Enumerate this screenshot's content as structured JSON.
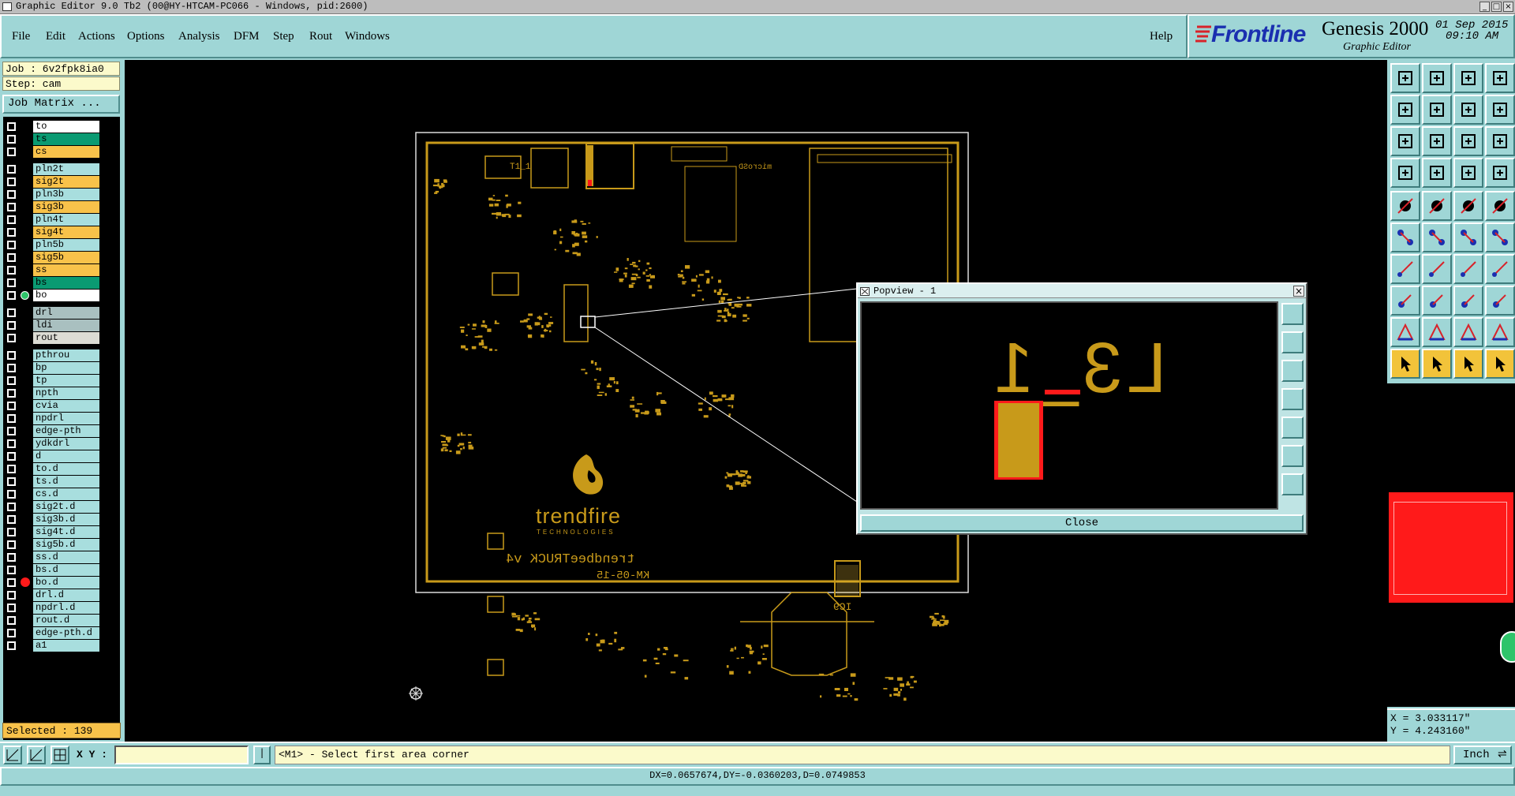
{
  "window": {
    "title": "Graphic Editor 9.0 Tb2 (00@HY-HTCAM-PC066 - Windows, pid:2600)",
    "controls": [
      "_",
      "□",
      "×"
    ]
  },
  "menu": {
    "items": [
      "File",
      "Edit",
      "Actions",
      "Options",
      "Analysis",
      "DFM",
      "Step",
      "Rout",
      "Windows"
    ],
    "help": "Help"
  },
  "brand": {
    "logo": "Frontline",
    "product": "Genesis 2000",
    "subtitle": "Graphic Editor",
    "date": "01 Sep 2015",
    "time": "09:10 AM"
  },
  "job": {
    "job_label": "Job : 6v2fpk8ia0",
    "step_label": "Step: cam",
    "matrix_button": "Job Matrix ..."
  },
  "layers": [
    {
      "name": "to",
      "color": "#ffffff"
    },
    {
      "name": "ts",
      "color": "#0a9a72"
    },
    {
      "name": "cs",
      "color": "#f8c24a"
    },
    {
      "name": "pln2t",
      "color": "#a8dede"
    },
    {
      "name": "sig2t",
      "color": "#f8c24a"
    },
    {
      "name": "pln3b",
      "color": "#a8dede"
    },
    {
      "name": "sig3b",
      "color": "#f8c24a"
    },
    {
      "name": "pln4t",
      "color": "#a8dede"
    },
    {
      "name": "sig4t",
      "color": "#f8c24a"
    },
    {
      "name": "pln5b",
      "color": "#a8dede"
    },
    {
      "name": "sig5b",
      "color": "#f8c24a"
    },
    {
      "name": "ss",
      "color": "#f8c24a"
    },
    {
      "name": "bs",
      "color": "#0a9a72"
    },
    {
      "name": "bo",
      "color": "#ffffff"
    },
    {
      "name": "drl",
      "color": "#a9c0c0"
    },
    {
      "name": "ldi",
      "color": "#a9c0c0"
    },
    {
      "name": "rout",
      "color": "#dcdcd4"
    },
    {
      "name": "pthrou",
      "color": "#a8dede"
    },
    {
      "name": "bp",
      "color": "#a8dede"
    },
    {
      "name": "tp",
      "color": "#a8dede"
    },
    {
      "name": "npth",
      "color": "#a8dede"
    },
    {
      "name": "cvia",
      "color": "#a8dede"
    },
    {
      "name": "npdrl",
      "color": "#a8dede"
    },
    {
      "name": "edge-pth",
      "color": "#a8dede"
    },
    {
      "name": "ydkdrl",
      "color": "#a8dede"
    },
    {
      "name": "d",
      "color": "#a8dede"
    },
    {
      "name": "to.d",
      "color": "#a8dede"
    },
    {
      "name": "ts.d",
      "color": "#a8dede"
    },
    {
      "name": "cs.d",
      "color": "#a8dede"
    },
    {
      "name": "sig2t.d",
      "color": "#a8dede"
    },
    {
      "name": "sig3b.d",
      "color": "#a8dede"
    },
    {
      "name": "sig4t.d",
      "color": "#a8dede"
    },
    {
      "name": "sig5b.d",
      "color": "#a8dede"
    },
    {
      "name": "ss.d",
      "color": "#a8dede"
    },
    {
      "name": "bs.d",
      "color": "#a8dede"
    },
    {
      "name": "bo.d",
      "color": "#a8dede"
    },
    {
      "name": "drl.d",
      "color": "#a8dede"
    },
    {
      "name": "npdrl.d",
      "color": "#a8dede"
    },
    {
      "name": "rout.d",
      "color": "#a8dede"
    },
    {
      "name": "edge-pth.d",
      "color": "#a8dede"
    },
    {
      "name": "a1",
      "color": "#a8dede"
    }
  ],
  "selected": "Selected : 139",
  "board": {
    "logo_name": "trendfire",
    "logo_sub": "TECHNOLOGIES",
    "product_text": "trendbeeTRUCK v4",
    "rev_text": "KM-05-15",
    "ic_label": "IC9",
    "label_t11": "T1_1",
    "label_micro": "microSD"
  },
  "popview": {
    "title": "Popview - 1",
    "content": "L3_1",
    "close_label": "Close"
  },
  "coords": {
    "x": "X = 3.033117\"",
    "y": "Y = 4.243160\""
  },
  "command": {
    "xy_label": "X Y :",
    "xy_value": "",
    "prompt": "<M1> - Select first area corner",
    "units": "Inch"
  },
  "status": "DX=0.0657674,DY=-0.0360203,D=0.0749853",
  "colors": {
    "panel": "#9fd6d6",
    "copper": "#c89a1a",
    "highlight": "#ff1a1a"
  }
}
